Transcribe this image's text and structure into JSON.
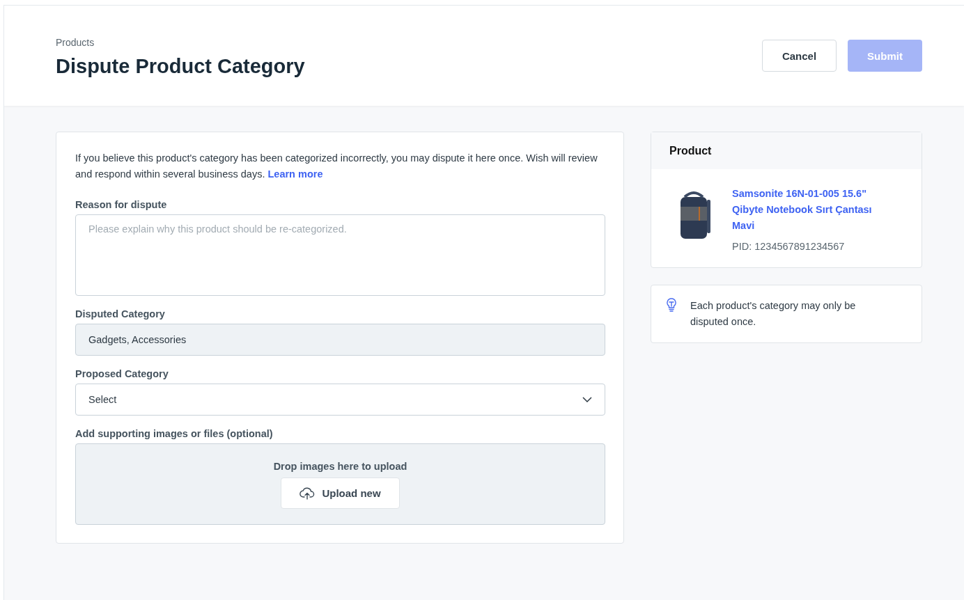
{
  "header": {
    "breadcrumb": "Products",
    "title": "Dispute Product Category",
    "buttons": [
      {
        "label": "Cancel",
        "kind": "secondary",
        "disabled": false
      },
      {
        "label": "Submit",
        "kind": "primary",
        "disabled": true
      }
    ]
  },
  "form": {
    "intro": "If you believe this product's category has been categorized incorrectly, you may dispute it here once. Wish will review and respond within several business days.",
    "intro_link": "Learn more",
    "fields": [
      {
        "kind": "textarea",
        "label": "Reason for dispute",
        "placeholder": "Please explain why this product should be re-categorized.",
        "disabled": false
      },
      {
        "kind": "text",
        "label": "Disputed Category",
        "value": "Gadgets, Accessories",
        "disabled": true
      },
      {
        "kind": "select",
        "label": "Proposed Category",
        "value": "Select",
        "disabled": false
      }
    ],
    "upload": {
      "label": "Add supporting images or files (optional)",
      "hint": "Drop images here to upload",
      "button": "Upload new"
    }
  },
  "product": {
    "heading": "Product",
    "name": "Samsonite 16N-01-005 15.6\" Qibyte Notebook Sırt Çantası Mavi",
    "pid": "PID: 1234567891234567"
  },
  "tip": "Each product's category may only be disputed once."
}
